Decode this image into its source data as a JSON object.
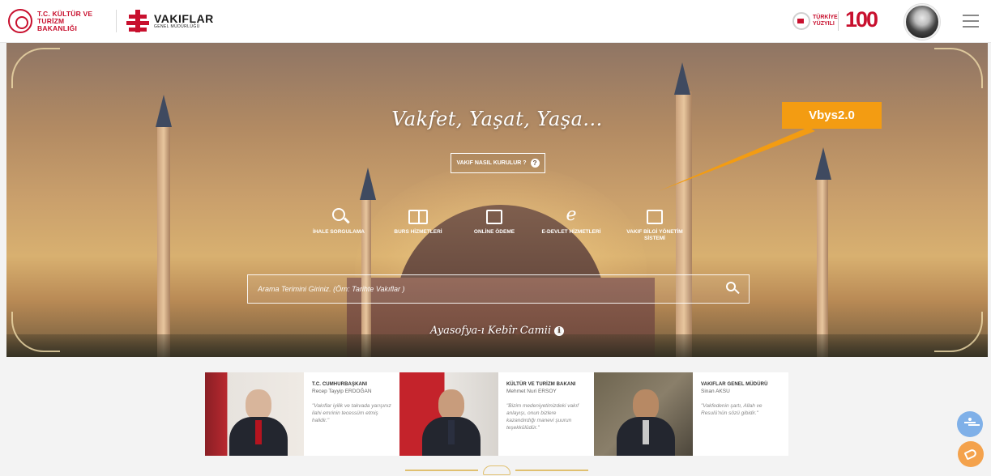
{
  "header": {
    "ministry_logo_text": "T.C. KÜLTÜR VE TURİZM BAKANLIĞI",
    "vakiflar_year": "",
    "vakiflar_main": "VAKIFLAR",
    "vakiflar_sub": "GENEL MÜDÜRLÜĞÜ",
    "turkiye_line1": "TÜRKİYE",
    "turkiye_line2": "YÜZYILI",
    "hundred": "100",
    "hundred_sub": ""
  },
  "hero": {
    "slogan": "Vakfet, Yaşat, Yaşa...",
    "how_button_label": "VAKIF NASIL KURULUR ?",
    "how_button_icon": "?",
    "services": [
      {
        "label": "İHALE SORGULAMA",
        "icon": "search-icon"
      },
      {
        "label": "BURS HİZMETLERİ",
        "icon": "book-icon"
      },
      {
        "label": "ONLİNE ÖDEME",
        "icon": "payment-card-icon"
      },
      {
        "label": "E-DEVLET HİZMETLERİ",
        "icon": "e-devlet-icon"
      },
      {
        "label": "VAKIF BİLGİ YÖNETİM SİSTEMİ",
        "icon": "id-card-icon"
      }
    ],
    "search_placeholder": "Arama Terimini Giriniz. (Örn: Tarihte Vakıflar )",
    "caption": "Ayasofya-ı Kebîr Camii"
  },
  "annotation": {
    "label": "Vbys2.0",
    "color": "#f39c12"
  },
  "leaders": [
    {
      "role": "T.C. CUMHURBAŞKANI",
      "name": "Recep Tayyip ERDOĞAN",
      "quote": "\"Vakıflar iyilik ve takvada yarışınız ilahi emrinin tecessüm etmiş halidir.\""
    },
    {
      "role": "KÜLTÜR VE TURİZM BAKANI",
      "name": "Mehmet Nuri ERSOY",
      "quote": "\"Bizim medeniyetimizdeki vakıf anlayışı, onun bizlere kazandırdığı manevi şuurun teşekkülüdür.\""
    },
    {
      "role": "VAKIFLAR GENEL MÜDÜRÜ",
      "name": "Sinan AKSU",
      "quote": "\"Vakfedenin şartı, Allah ve Resulü'nün sözü gibidir.\""
    }
  ],
  "colors": {
    "brand_red": "#c8102e",
    "accent_orange": "#f39c12",
    "accessibility_blue": "#7fb0e8"
  }
}
